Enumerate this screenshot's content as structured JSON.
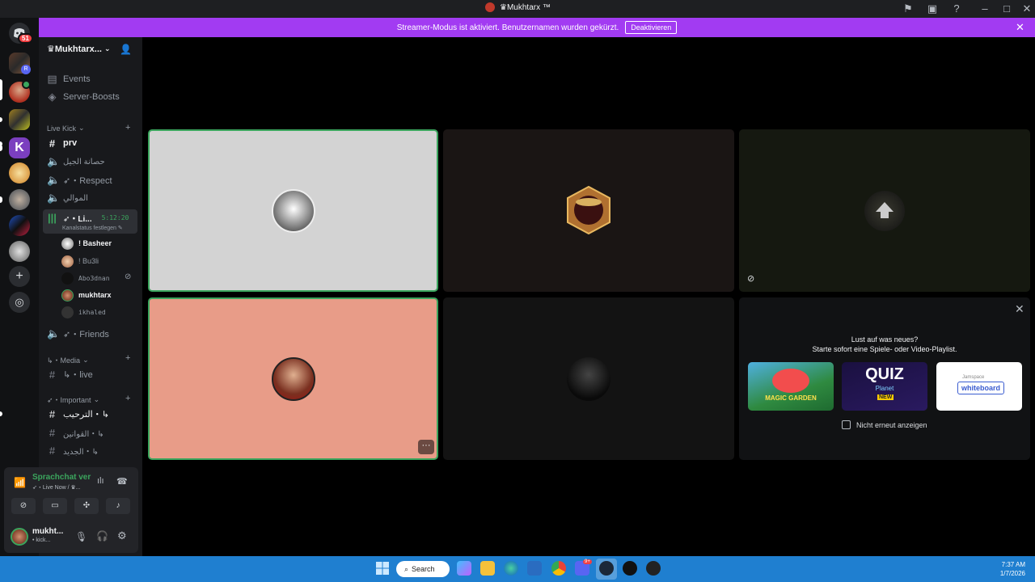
{
  "window": {
    "title": "♛Mukhtarx ™",
    "help_icon": "help-icon"
  },
  "banner": {
    "message": "Streamer-Modus ist aktiviert. Benutzernamen wurden gekürzt.",
    "action_label": "Deaktivieren"
  },
  "rail": {
    "badge_count": "51"
  },
  "server": {
    "name": "♛Mukhtarx..."
  },
  "nav": {
    "events_label": "Events",
    "boosts_label": "Server-Boosts"
  },
  "categories": {
    "live_kick": "Live Kick",
    "media": "↳・Media",
    "important": "➶・Important"
  },
  "channels": {
    "prv": "prv",
    "ch2": "حصانة الجيل",
    "respect": "➶・Respect",
    "ch4": "الموالي",
    "live": "➶・Li...",
    "live_timer": "5:12:20",
    "live_status": "Kanalstatus festlegen",
    "friends": "➶・Friends",
    "media_live": "↳・live",
    "welcome": "الترحيب・↳",
    "rules": "القوانين・↳",
    "new": "الجديد・↳"
  },
  "members": [
    {
      "name": "! Basheer",
      "bold": true
    },
    {
      "name": "! Bu3li",
      "bold": false
    },
    {
      "name": "Abo3dnan",
      "bold": false
    },
    {
      "name": "mukhtarx",
      "bold": true
    },
    {
      "name": "ikhaled",
      "bold": false
    }
  ],
  "voice": {
    "status": "Sprachchat ver",
    "channel": "➶・Live Now / ♛...",
    "user_name": "mukht...",
    "user_status": "• kick..."
  },
  "activity": {
    "title": "Lust auf was neues?",
    "subtitle": "Starte sofort eine Spiele- oder Video-Playlist.",
    "cards": [
      "MAGIC GARDEN",
      "QUIZ",
      "whiteboard"
    ],
    "quiz_sub": "Planet",
    "quiz_new": "NEW",
    "wb_brand": "Jamspace",
    "checkbox_label": "Nicht erneut anzeigen"
  },
  "taskbar": {
    "search_label": "Search",
    "time": "7:37 AM",
    "date": "1/7/2026",
    "discord_badge": "9+"
  },
  "colors": {
    "accent_purple": "#a23bf2",
    "speaking_green": "#3ba55d",
    "taskbar_blue": "#1f7fd0"
  }
}
